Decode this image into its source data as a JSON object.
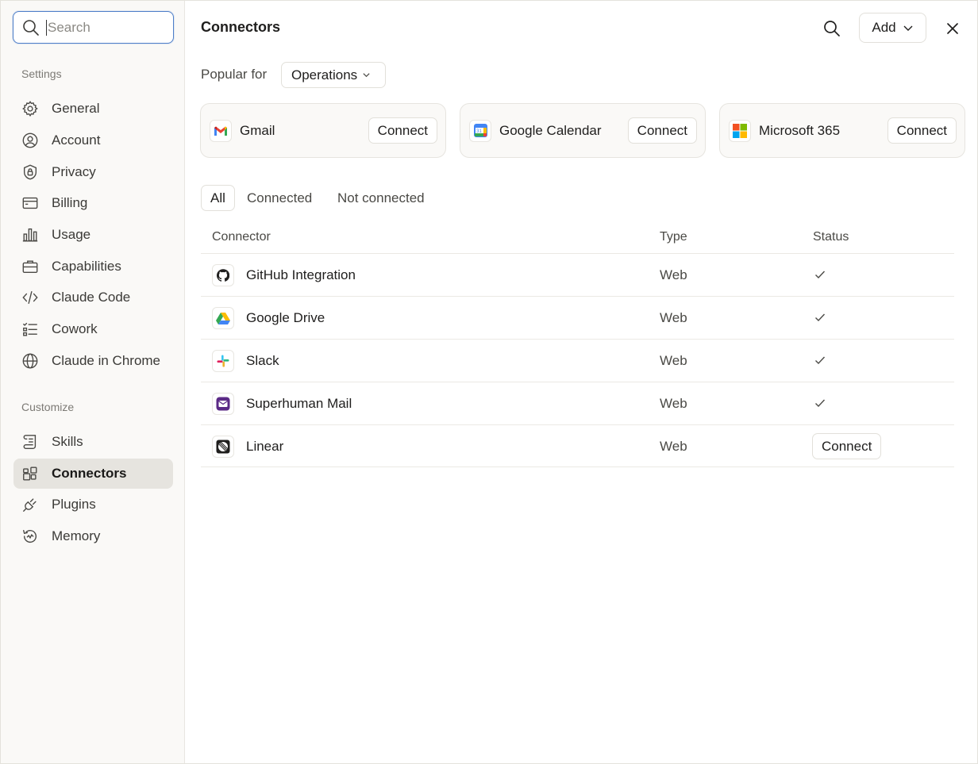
{
  "sidebar": {
    "search": {
      "placeholder": "Search",
      "value": ""
    },
    "settings_label": "Settings",
    "settings_items": [
      {
        "label": "General",
        "icon": "gear-icon"
      },
      {
        "label": "Account",
        "icon": "user-circle-icon"
      },
      {
        "label": "Privacy",
        "icon": "shield-lock-icon"
      },
      {
        "label": "Billing",
        "icon": "credit-card-icon"
      },
      {
        "label": "Usage",
        "icon": "bar-chart-icon"
      },
      {
        "label": "Capabilities",
        "icon": "briefcase-icon"
      },
      {
        "label": "Claude Code",
        "icon": "code-icon"
      },
      {
        "label": "Cowork",
        "icon": "checklist-icon"
      },
      {
        "label": "Claude in Chrome",
        "icon": "globe-icon"
      }
    ],
    "customize_label": "Customize",
    "customize_items": [
      {
        "label": "Skills",
        "icon": "scroll-icon"
      },
      {
        "label": "Connectors",
        "icon": "connectors-icon",
        "active": true
      },
      {
        "label": "Plugins",
        "icon": "plug-icon"
      },
      {
        "label": "Memory",
        "icon": "memory-icon"
      }
    ]
  },
  "header": {
    "title": "Connectors",
    "add_label": "Add"
  },
  "popular": {
    "label": "Popular for",
    "selected": "Operations",
    "cards": [
      {
        "name": "Gmail",
        "icon": "gmail-icon",
        "action": "Connect"
      },
      {
        "name": "Google Calendar",
        "icon": "google-calendar-icon",
        "action": "Connect"
      },
      {
        "name": "Microsoft 365",
        "icon": "microsoft-icon",
        "action": "Connect"
      }
    ]
  },
  "filters": {
    "tabs": [
      "All",
      "Connected",
      "Not connected"
    ],
    "active": "All"
  },
  "table": {
    "columns": [
      "Connector",
      "Type",
      "Status"
    ],
    "rows": [
      {
        "name": "GitHub Integration",
        "type": "Web",
        "status": "connected",
        "icon": "github-icon"
      },
      {
        "name": "Google Drive",
        "type": "Web",
        "status": "connected",
        "icon": "google-drive-icon"
      },
      {
        "name": "Slack",
        "type": "Web",
        "status": "connected",
        "icon": "slack-icon"
      },
      {
        "name": "Superhuman Mail",
        "type": "Web",
        "status": "connected",
        "icon": "superhuman-icon"
      },
      {
        "name": "Linear",
        "type": "Web",
        "status": "not_connected",
        "action": "Connect",
        "icon": "linear-icon"
      }
    ]
  },
  "colors": {
    "accent_focus": "#4f7fc9",
    "active_nav_bg": "#e6e4df",
    "sidebar_bg": "#faf9f7"
  }
}
